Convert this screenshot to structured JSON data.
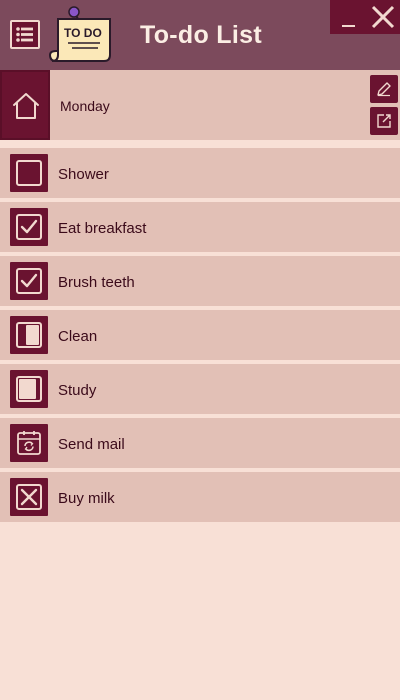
{
  "app": {
    "title": "To-do List",
    "logo_text": "TO DO"
  },
  "day": {
    "label": "Monday"
  },
  "tasks": [
    {
      "label": "Shower",
      "icon": "empty-checkbox-icon"
    },
    {
      "label": "Eat breakfast",
      "icon": "checked-checkbox-icon"
    },
    {
      "label": "Brush teeth",
      "icon": "checked-checkbox-icon"
    },
    {
      "label": "Clean",
      "icon": "half-filled-progress-icon"
    },
    {
      "label": "Study",
      "icon": "mostly-filled-progress-icon"
    },
    {
      "label": "Send mail",
      "icon": "calendar-refresh-icon"
    },
    {
      "label": "Buy milk",
      "icon": "crossed-box-icon"
    }
  ],
  "colors": {
    "header": "#7c4a5c",
    "accent": "#6a1330",
    "row": "#e2c0b6",
    "background": "#f8e0d6",
    "title_text": "#fbeee4"
  }
}
